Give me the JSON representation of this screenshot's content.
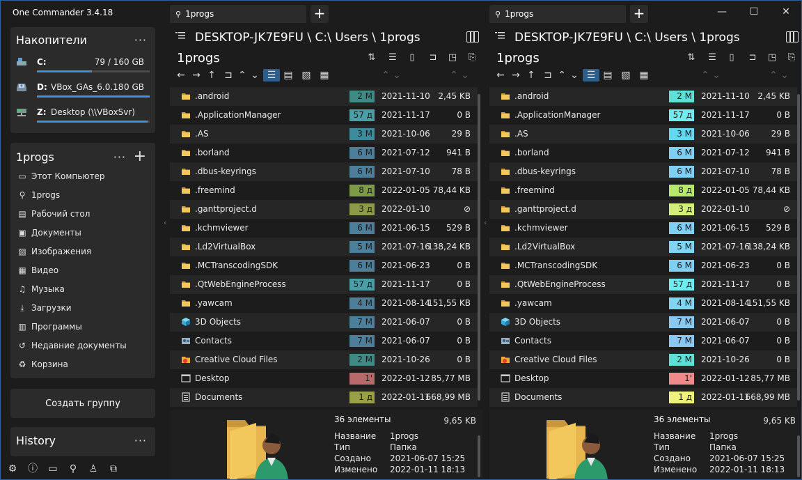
{
  "app": {
    "title": "One Commander 3.4.18"
  },
  "drives_card": {
    "title": "Накопители",
    "drives": [
      {
        "letter": "C:",
        "name": "",
        "size": "79 / 160 GB",
        "fill": 0.49
      },
      {
        "letter": "D:",
        "name": "VBox_GAs_6.0.18",
        "size": "0 GB",
        "fill": 1.0
      },
      {
        "letter": "Z:",
        "name": "Desktop (\\\\VBoxSvr)",
        "size": "",
        "fill": 0.98
      }
    ]
  },
  "places_card": {
    "title": "1progs",
    "items": [
      {
        "label": "Этот Компьютер",
        "icon": "computer-icon"
      },
      {
        "label": "1progs",
        "icon": "user-icon"
      },
      {
        "label": "Рабочий стол",
        "icon": "desktop-icon"
      },
      {
        "label": "Документы",
        "icon": "documents-icon"
      },
      {
        "label": "Изображения",
        "icon": "images-icon"
      },
      {
        "label": "Видео",
        "icon": "video-icon"
      },
      {
        "label": "Музыка",
        "icon": "music-icon"
      },
      {
        "label": "Загрузки",
        "icon": "download-icon"
      },
      {
        "label": "Программы",
        "icon": "programs-icon"
      },
      {
        "label": "Недавние документы",
        "icon": "recent-icon"
      },
      {
        "label": "Корзина",
        "icon": "trash-icon"
      }
    ]
  },
  "create_group_label": "Создать группу",
  "history_card": {
    "title": "History"
  },
  "panes": [
    {
      "tab_label": "1progs",
      "path": "DESKTOP-JK7E9FU \\ C:\\ Users \\ 1progs",
      "folder_title": "1progs",
      "files": [
        {
          "name": ".android",
          "icon": "folder",
          "age": "2 M",
          "age_color": "#3f8a84",
          "date": "2021-11-10",
          "size": "2,45 KB"
        },
        {
          "name": ".ApplicationManager",
          "icon": "folder",
          "age": "57 д",
          "age_color": "#4b9ea6",
          "date": "2021-11-17",
          "size": "0 B"
        },
        {
          "name": ".AS",
          "icon": "folder",
          "age": "3 M",
          "age_color": "#3f8a9c",
          "date": "2021-10-06",
          "size": "29 B"
        },
        {
          "name": ".borland",
          "icon": "folder",
          "age": "6 M",
          "age_color": "#4d7e9a",
          "date": "2021-07-12",
          "size": "941 B"
        },
        {
          "name": ".dbus-keyrings",
          "icon": "folder",
          "age": "6 M",
          "age_color": "#4d7e9a",
          "date": "2021-07-10",
          "size": "78 B"
        },
        {
          "name": ".freemind",
          "icon": "folder",
          "age": "8 д",
          "age_color": "#7d9a48",
          "date": "2022-01-05",
          "size": "78,44 KB"
        },
        {
          "name": ".ganttproject.d",
          "icon": "folder",
          "age": "3 д",
          "age_color": "#8d9a48",
          "date": "2022-01-10",
          "size": "⊘"
        },
        {
          "name": ".kchmviewer",
          "icon": "folder",
          "age": "6 M",
          "age_color": "#4d7e9a",
          "date": "2021-06-15",
          "size": "529 B"
        },
        {
          "name": ".Ld2VirtualBox",
          "icon": "folder",
          "age": "5 M",
          "age_color": "#4d7e9a",
          "date": "2021-07-16",
          "size": "138,24 KB"
        },
        {
          "name": ".MCTranscodingSDK",
          "icon": "folder",
          "age": "6 M",
          "age_color": "#4d7e9a",
          "date": "2021-06-23",
          "size": "0 B"
        },
        {
          "name": ".QtWebEngineProcess",
          "icon": "folder",
          "age": "57 д",
          "age_color": "#4b9ea6",
          "date": "2021-11-17",
          "size": "0 B"
        },
        {
          "name": ".yawcam",
          "icon": "folder",
          "age": "4 M",
          "age_color": "#4d7e9a",
          "date": "2021-08-14",
          "size": "151,55 KB"
        },
        {
          "name": "3D Objects",
          "icon": "cube",
          "age": "7 M",
          "age_color": "#4d7e9a",
          "date": "2021-06-07",
          "size": "0 B"
        },
        {
          "name": "Contacts",
          "icon": "contacts",
          "age": "7 M",
          "age_color": "#4d7e9a",
          "date": "2021-06-07",
          "size": "0 B"
        },
        {
          "name": "Creative Cloud Files",
          "icon": "cc",
          "age": "2 M",
          "age_color": "#3f8a84",
          "date": "2021-10-26",
          "size": "0 B"
        },
        {
          "name": "Desktop",
          "icon": "desktop",
          "age": "1'",
          "age_color": "#b86a6a",
          "date": "2022-01-12",
          "size": "85,77 MB"
        },
        {
          "name": "Documents",
          "icon": "doc",
          "age": "1 д",
          "age_color": "#9aa048",
          "date": "2022-01-11",
          "size": "668,99 MB"
        }
      ],
      "details": {
        "count": "36 элементы",
        "total": "9,65 KB",
        "rows": [
          {
            "label": "Название",
            "value": "1progs"
          },
          {
            "label": "Тип",
            "value": "Папка"
          },
          {
            "label": "Создано",
            "value": "2021-06-07  15:25"
          },
          {
            "label": "Изменено",
            "value": "2022-01-11  18:13"
          }
        ]
      }
    },
    {
      "tab_label": "1progs",
      "path": "DESKTOP-JK7E9FU \\ C:\\ Users \\ 1progs",
      "folder_title": "1progs",
      "files": [
        {
          "name": ".android",
          "icon": "folder",
          "age": "2 M",
          "age_color": "#5ee0d6",
          "date": "2021-11-10",
          "size": "2,45 KB"
        },
        {
          "name": ".ApplicationManager",
          "icon": "folder",
          "age": "57 д",
          "age_color": "#70ecef",
          "date": "2021-11-17",
          "size": "0 B"
        },
        {
          "name": ".AS",
          "icon": "folder",
          "age": "3 M",
          "age_color": "#64d8ee",
          "date": "2021-10-06",
          "size": "29 B"
        },
        {
          "name": ".borland",
          "icon": "folder",
          "age": "6 M",
          "age_color": "#7fcff2",
          "date": "2021-07-12",
          "size": "941 B"
        },
        {
          "name": ".dbus-keyrings",
          "icon": "folder",
          "age": "6 M",
          "age_color": "#7fcff2",
          "date": "2021-07-10",
          "size": "78 B"
        },
        {
          "name": ".freemind",
          "icon": "folder",
          "age": "8 д",
          "age_color": "#b8e86a",
          "date": "2022-01-05",
          "size": "78,44 KB"
        },
        {
          "name": ".ganttproject.d",
          "icon": "folder",
          "age": "3 д",
          "age_color": "#d2ef7a",
          "date": "2022-01-10",
          "size": "⊘"
        },
        {
          "name": ".kchmviewer",
          "icon": "folder",
          "age": "6 M",
          "age_color": "#7fcff2",
          "date": "2021-06-15",
          "size": "529 B"
        },
        {
          "name": ".Ld2VirtualBox",
          "icon": "folder",
          "age": "5 M",
          "age_color": "#7fd6f2",
          "date": "2021-07-16",
          "size": "138,24 KB"
        },
        {
          "name": ".MCTranscodingSDK",
          "icon": "folder",
          "age": "6 M",
          "age_color": "#7fcff2",
          "date": "2021-06-23",
          "size": "0 B"
        },
        {
          "name": ".QtWebEngineProcess",
          "icon": "folder",
          "age": "57 д",
          "age_color": "#70ecef",
          "date": "2021-11-17",
          "size": "0 B"
        },
        {
          "name": ".yawcam",
          "icon": "folder",
          "age": "4 M",
          "age_color": "#7fd6f2",
          "date": "2021-08-14",
          "size": "151,55 KB"
        },
        {
          "name": "3D Objects",
          "icon": "cube",
          "age": "7 M",
          "age_color": "#8ac8f2",
          "date": "2021-06-07",
          "size": "0 B"
        },
        {
          "name": "Contacts",
          "icon": "contacts",
          "age": "7 M",
          "age_color": "#8ac8f2",
          "date": "2021-06-07",
          "size": "0 B"
        },
        {
          "name": "Creative Cloud Files",
          "icon": "cc",
          "age": "2 M",
          "age_color": "#5ee0d6",
          "date": "2021-10-26",
          "size": "0 B"
        },
        {
          "name": "Desktop",
          "icon": "desktop",
          "age": "1'",
          "age_color": "#f08a8a",
          "date": "2022-01-12",
          "size": "85,77 MB"
        },
        {
          "name": "Documents",
          "icon": "doc",
          "age": "1 д",
          "age_color": "#eef27a",
          "date": "2022-01-11",
          "size": "668,99 MB"
        }
      ],
      "details": {
        "count": "36 элементы",
        "total": "9,65 KB",
        "rows": [
          {
            "label": "Название",
            "value": "1progs"
          },
          {
            "label": "Тип",
            "value": "Папка"
          },
          {
            "label": "Создано",
            "value": "2021-06-07  15:25"
          },
          {
            "label": "Изменено",
            "value": "2022-01-11  18:13"
          }
        ]
      }
    }
  ],
  "colors": {
    "accent": "#3c8fe0",
    "card_bg": "#2b2b2b",
    "window_bg": "#1c1c1c",
    "folder": "#f2c75c"
  }
}
